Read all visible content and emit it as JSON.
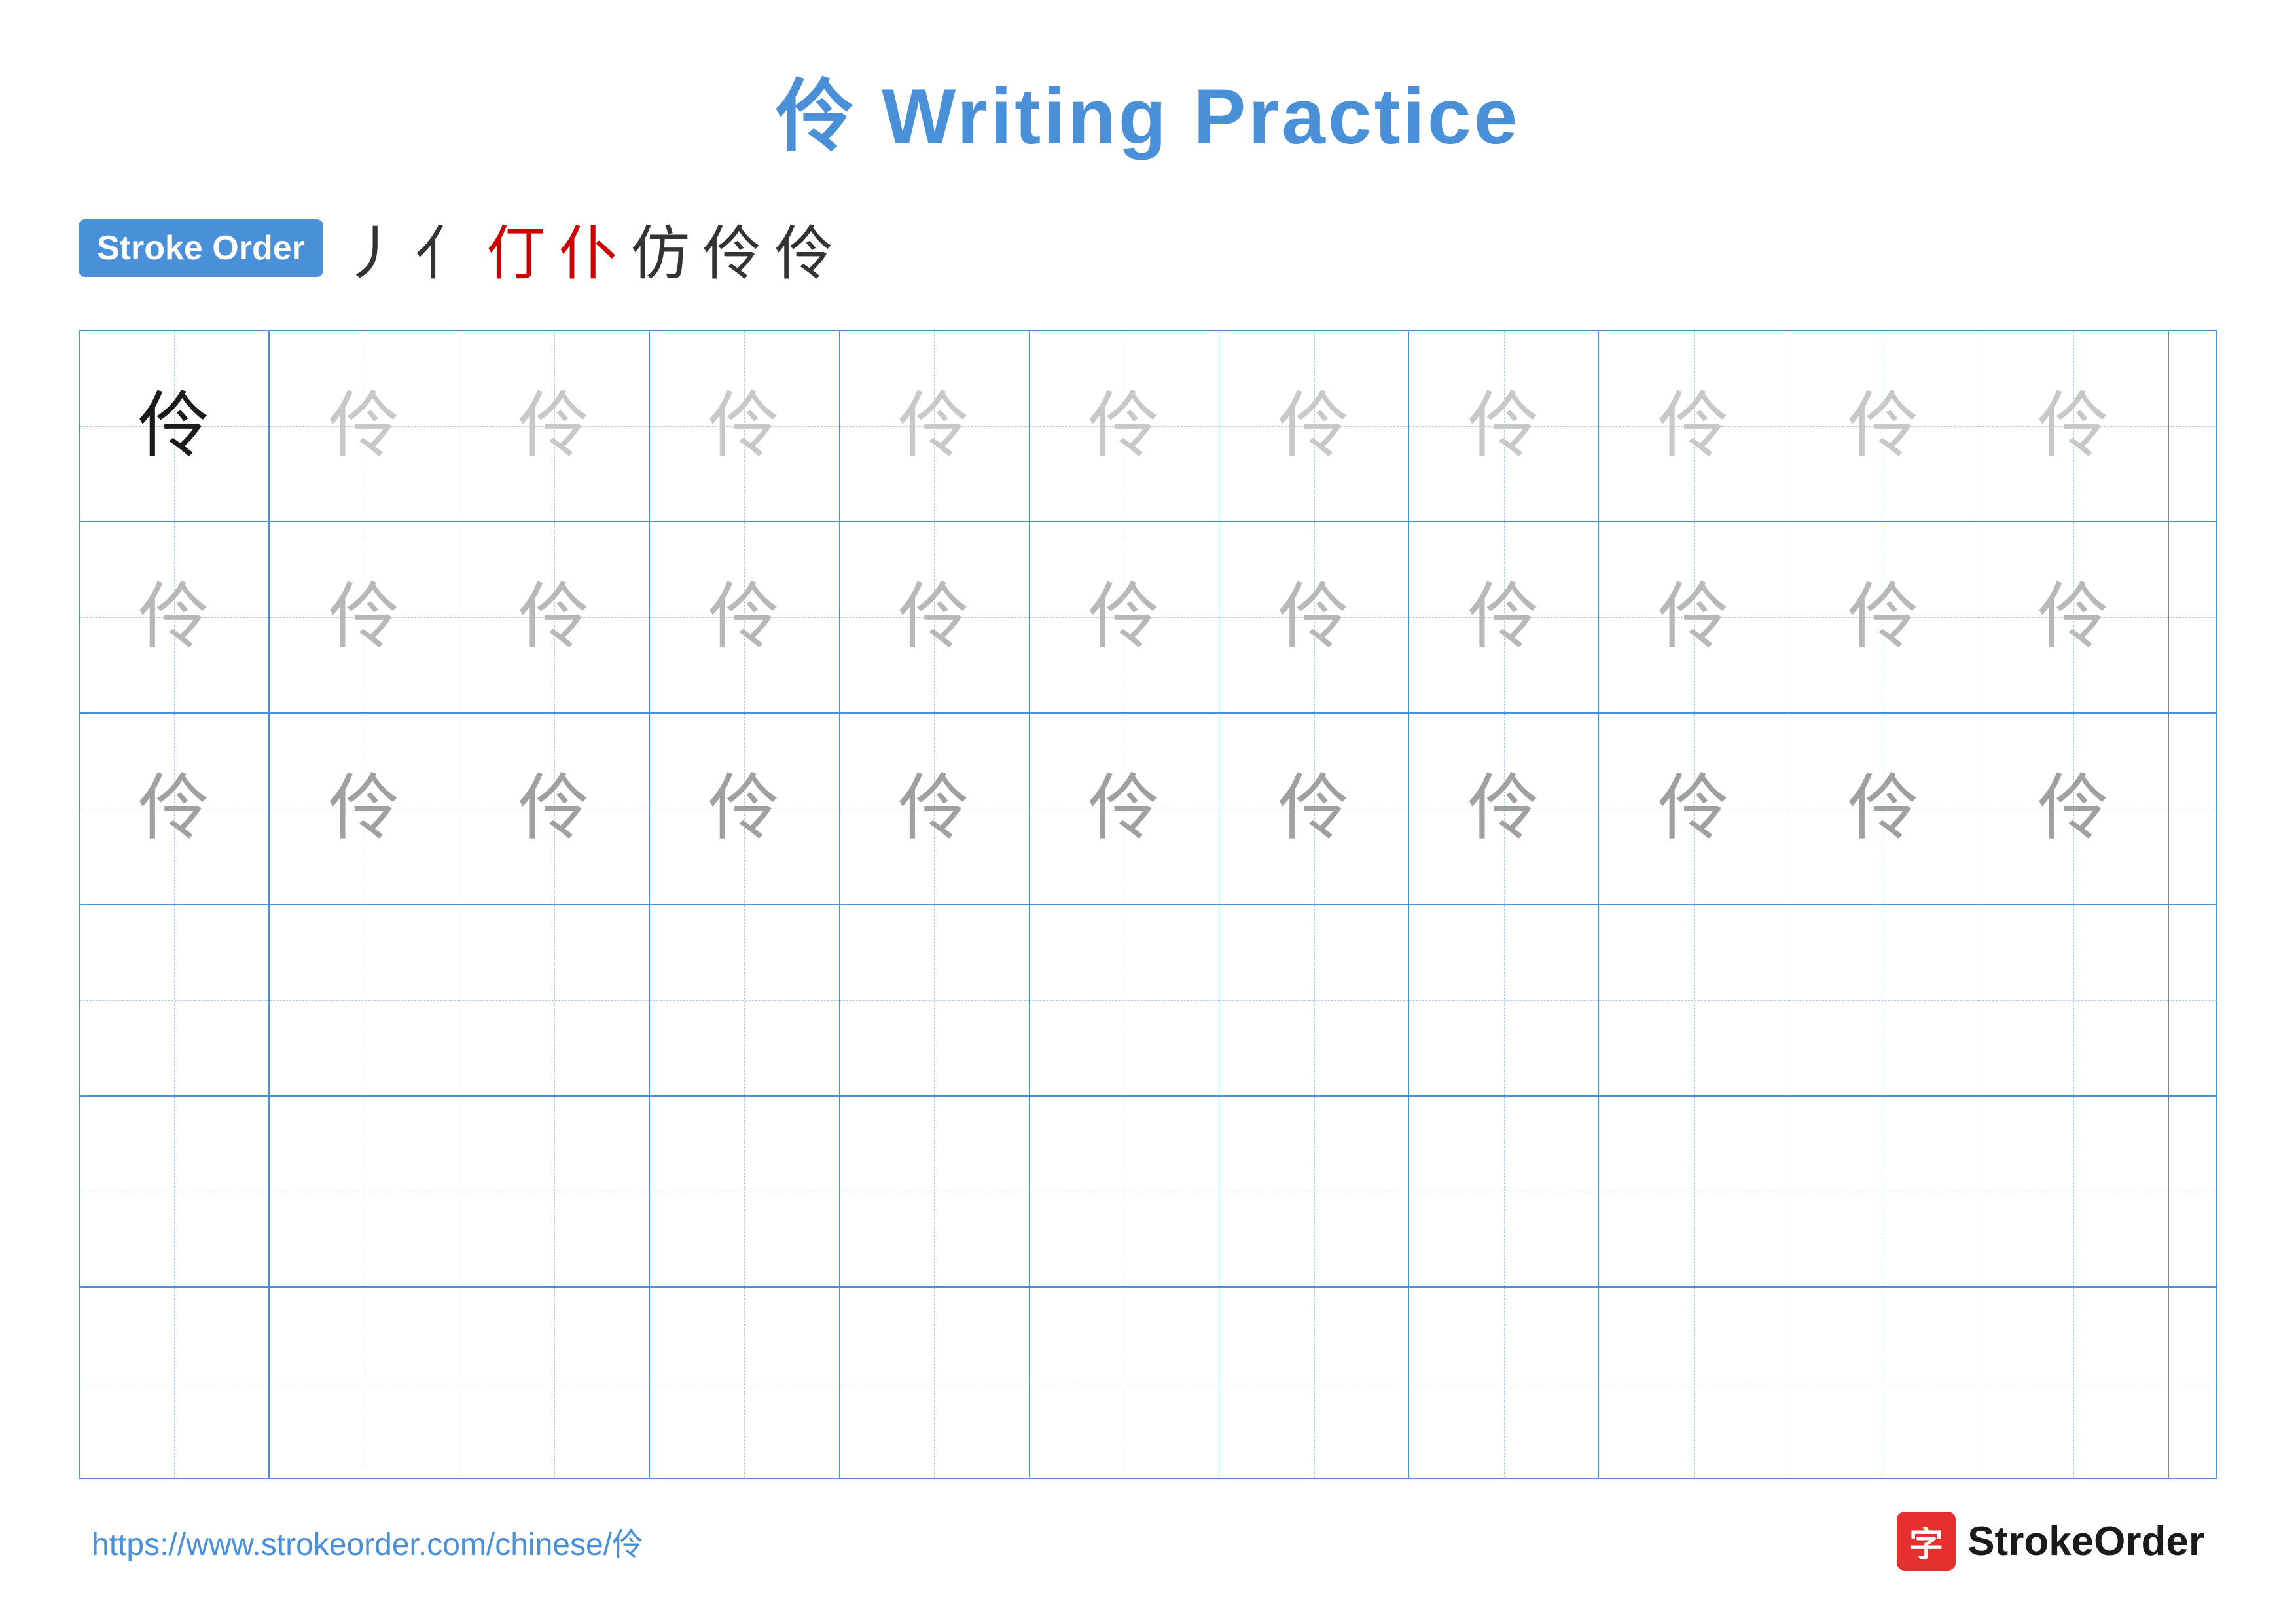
{
  "title": {
    "char": "伶",
    "label": "Writing Practice",
    "full": "伶 Writing Practice"
  },
  "stroke_order": {
    "badge_label": "Stroke Order",
    "strokes": [
      "丿",
      "亻",
      "仃",
      "仆",
      "仿",
      "伶",
      "伶"
    ]
  },
  "grid": {
    "cols": 13,
    "rows": 6,
    "char": "伶",
    "row_contents": [
      [
        "dark",
        "light1",
        "light1",
        "light1",
        "light1",
        "light1",
        "light1",
        "light1",
        "light1",
        "light1",
        "light1",
        "light1",
        "light1"
      ],
      [
        "light2",
        "light2",
        "light2",
        "light2",
        "light2",
        "light2",
        "light2",
        "light2",
        "light2",
        "light2",
        "light2",
        "light2",
        "light2"
      ],
      [
        "light3",
        "light3",
        "light3",
        "light3",
        "light3",
        "light3",
        "light3",
        "light3",
        "light3",
        "light3",
        "light3",
        "light3",
        "light3"
      ],
      [
        "empty",
        "empty",
        "empty",
        "empty",
        "empty",
        "empty",
        "empty",
        "empty",
        "empty",
        "empty",
        "empty",
        "empty",
        "empty"
      ],
      [
        "empty",
        "empty",
        "empty",
        "empty",
        "empty",
        "empty",
        "empty",
        "empty",
        "empty",
        "empty",
        "empty",
        "empty",
        "empty"
      ],
      [
        "empty",
        "empty",
        "empty",
        "empty",
        "empty",
        "empty",
        "empty",
        "empty",
        "empty",
        "empty",
        "empty",
        "empty",
        "empty"
      ]
    ]
  },
  "footer": {
    "url": "https://www.strokeorder.com/chinese/伶",
    "logo_char": "字",
    "logo_text": "StrokeOrder"
  }
}
